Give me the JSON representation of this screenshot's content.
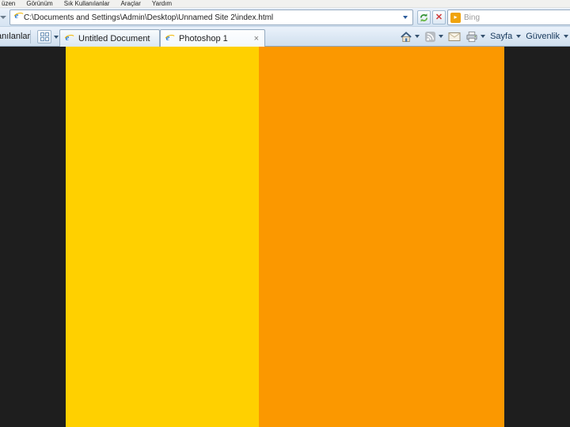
{
  "menu_bar": {
    "items": [
      "üzen",
      "Görünüm",
      "Sık Kullanılanlar",
      "Araçlar",
      "Yardım"
    ]
  },
  "address_bar": {
    "url": "C:\\Documents and Settings\\Admin\\Desktop\\Unnamed Site 2\\index.html"
  },
  "search_box": {
    "placeholder": "Bing",
    "logo_glyph": "▸"
  },
  "favorites_bar": {
    "partial_label": "anılanlar"
  },
  "tab_bar": {
    "tabs": [
      {
        "label": "Untitled Document",
        "active": false
      },
      {
        "label": "Photoshop 1",
        "active": true
      }
    ],
    "close_glyph": "×"
  },
  "command_bar": {
    "page_label": "Sayfa",
    "security_label": "Güvenlik"
  },
  "content": {
    "background_color": "#1E1E1E",
    "left_column_color": "#FFD000",
    "right_column_color": "#FB9800"
  }
}
